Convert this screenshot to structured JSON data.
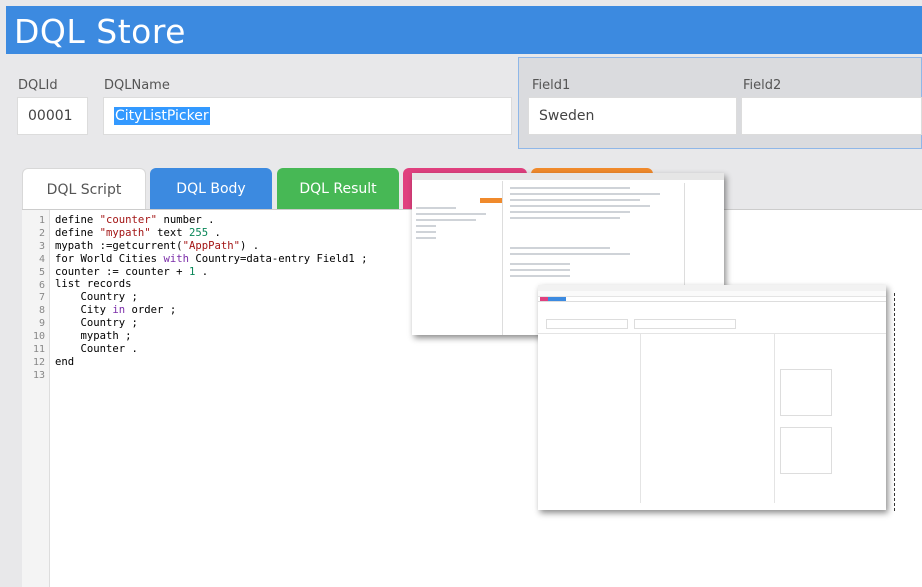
{
  "header": {
    "title": "DQL Store"
  },
  "form": {
    "dqlid_label": "DQLId",
    "dqlid_value": "00001",
    "dqlname_label": "DQLName",
    "dqlname_value": "CityListPicker",
    "field1_label": "Field1",
    "field1_value": "Sweden",
    "field2_label": "Field2",
    "field2_value": ""
  },
  "tabs": [
    {
      "label": "DQL Script"
    },
    {
      "label": "DQL Body"
    },
    {
      "label": "DQL Result"
    }
  ],
  "colors": {
    "header": "#3c8ae0",
    "tab_body": "#3c8ae0",
    "tab_result": "#47b855",
    "tab_pink": "#e0407e",
    "tab_orange": "#f08a2c",
    "selection": "#3399ff"
  },
  "editor": {
    "line_numbers": [
      "1",
      "2",
      "3",
      "4",
      "5",
      "6",
      "7",
      "8",
      "9",
      "10",
      "11",
      "12",
      "13"
    ],
    "lines": [
      [
        {
          "t": "define "
        },
        {
          "t": "\"counter\"",
          "c": "s"
        },
        {
          "t": " number ."
        }
      ],
      [
        {
          "t": "define "
        },
        {
          "t": "\"mypath\"",
          "c": "s"
        },
        {
          "t": " text "
        },
        {
          "t": "255",
          "c": "n"
        },
        {
          "t": " ."
        }
      ],
      [
        {
          "t": "mypath :=getcurrent("
        },
        {
          "t": "\"AppPath\"",
          "c": "s"
        },
        {
          "t": ") ."
        }
      ],
      [
        {
          "t": "for World Cities "
        },
        {
          "t": "with",
          "c": "k"
        },
        {
          "t": " Country=data-entry Field1 ;"
        }
      ],
      [
        {
          "t": "counter := counter + "
        },
        {
          "t": "1",
          "c": "n"
        },
        {
          "t": " ."
        }
      ],
      [
        {
          "t": "list records"
        }
      ],
      [
        {
          "t": "    Country ;"
        }
      ],
      [
        {
          "t": "    City "
        },
        {
          "t": "in",
          "c": "k"
        },
        {
          "t": " order ;"
        }
      ],
      [
        {
          "t": "    Country ;"
        }
      ],
      [
        {
          "t": "    mypath ;"
        }
      ],
      [
        {
          "t": "    Counter ."
        }
      ],
      [
        {
          "t": "end"
        }
      ],
      [
        {
          "t": ""
        }
      ]
    ]
  }
}
